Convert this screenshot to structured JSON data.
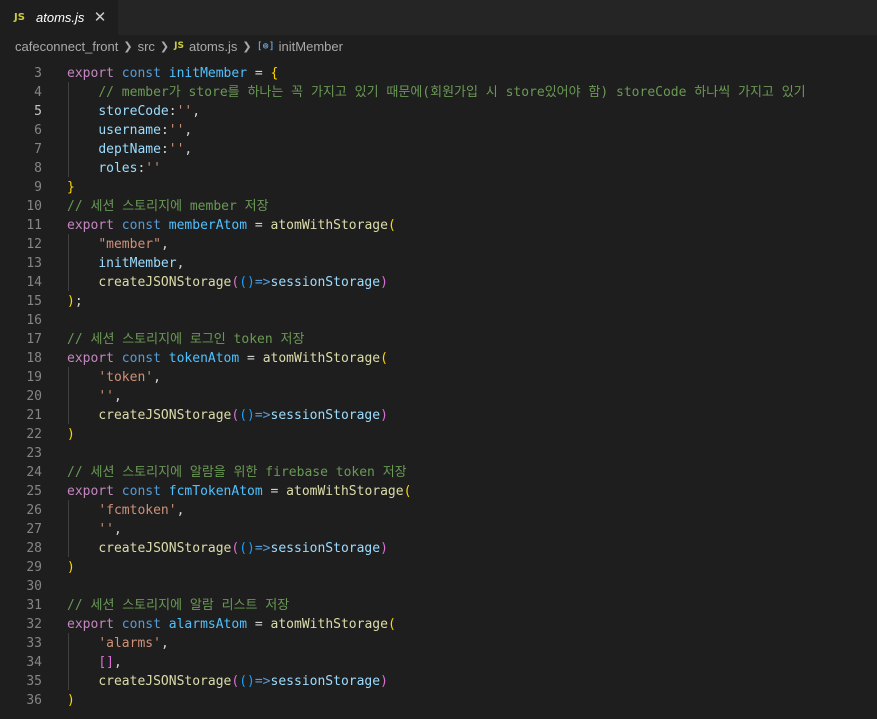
{
  "tab": {
    "icon": "JS",
    "label": "atoms.js",
    "close": "✕"
  },
  "breadcrumb": {
    "project": "cafeconnect_front",
    "folder": "src",
    "file_icon": "JS",
    "file": "atoms.js",
    "symbol_icon": "[⊚]",
    "symbol": "initMember"
  },
  "editor": {
    "active_line": "5",
    "lines": [
      {
        "n": "3",
        "t": [
          [
            "kw",
            "export"
          ],
          [
            "tx",
            " "
          ],
          [
            "st",
            "const"
          ],
          [
            "tx",
            " "
          ],
          [
            "cn",
            "initMember"
          ],
          [
            "tx",
            " = "
          ],
          [
            "b1",
            "{"
          ]
        ]
      },
      {
        "n": "4",
        "t": [
          [
            "tx",
            "    "
          ],
          [
            "cm",
            "// member가 store를 하나는 꼭 가지고 있기 때문에(회원가입 시 store있어야 함) storeCode 하나씩 가지고 있기"
          ]
        ]
      },
      {
        "n": "5",
        "t": [
          [
            "tx",
            "    "
          ],
          [
            "pr",
            "storeCode"
          ],
          [
            "tx",
            ":"
          ],
          [
            "str",
            "''"
          ],
          [
            "tx",
            ","
          ]
        ]
      },
      {
        "n": "6",
        "t": [
          [
            "tx",
            "    "
          ],
          [
            "pr",
            "username"
          ],
          [
            "tx",
            ":"
          ],
          [
            "str",
            "''"
          ],
          [
            "tx",
            ","
          ]
        ]
      },
      {
        "n": "7",
        "t": [
          [
            "tx",
            "    "
          ],
          [
            "pr",
            "deptName"
          ],
          [
            "tx",
            ":"
          ],
          [
            "str",
            "''"
          ],
          [
            "tx",
            ","
          ]
        ]
      },
      {
        "n": "8",
        "t": [
          [
            "tx",
            "    "
          ],
          [
            "pr",
            "roles"
          ],
          [
            "tx",
            ":"
          ],
          [
            "str",
            "''"
          ]
        ]
      },
      {
        "n": "9",
        "t": [
          [
            "b1",
            "}"
          ]
        ]
      },
      {
        "n": "10",
        "t": [
          [
            "cm",
            "// 세션 스토리지에 member 저장"
          ]
        ]
      },
      {
        "n": "11",
        "t": [
          [
            "kw",
            "export"
          ],
          [
            "tx",
            " "
          ],
          [
            "st",
            "const"
          ],
          [
            "tx",
            " "
          ],
          [
            "cn",
            "memberAtom"
          ],
          [
            "tx",
            " = "
          ],
          [
            "fn",
            "atomWithStorage"
          ],
          [
            "b1",
            "("
          ]
        ]
      },
      {
        "n": "12",
        "t": [
          [
            "tx",
            "    "
          ],
          [
            "str",
            "\"member\""
          ],
          [
            "tx",
            ","
          ]
        ]
      },
      {
        "n": "13",
        "t": [
          [
            "tx",
            "    "
          ],
          [
            "pr",
            "initMember"
          ],
          [
            "tx",
            ","
          ]
        ]
      },
      {
        "n": "14",
        "t": [
          [
            "tx",
            "    "
          ],
          [
            "fn",
            "createJSONStorage"
          ],
          [
            "b2",
            "("
          ],
          [
            "b3",
            "()"
          ],
          [
            "st",
            "=>"
          ],
          [
            "pr",
            "sessionStorage"
          ],
          [
            "b2",
            ")"
          ]
        ]
      },
      {
        "n": "15",
        "t": [
          [
            "b1",
            ")"
          ],
          [
            "tx",
            ";"
          ]
        ]
      },
      {
        "n": "16",
        "t": []
      },
      {
        "n": "17",
        "t": [
          [
            "cm",
            "// 세션 스토리지에 로그인 token 저장"
          ]
        ]
      },
      {
        "n": "18",
        "t": [
          [
            "kw",
            "export"
          ],
          [
            "tx",
            " "
          ],
          [
            "st",
            "const"
          ],
          [
            "tx",
            " "
          ],
          [
            "cn",
            "tokenAtom"
          ],
          [
            "tx",
            " = "
          ],
          [
            "fn",
            "atomWithStorage"
          ],
          [
            "b1",
            "("
          ]
        ]
      },
      {
        "n": "19",
        "t": [
          [
            "tx",
            "    "
          ],
          [
            "str",
            "'token'"
          ],
          [
            "tx",
            ","
          ]
        ]
      },
      {
        "n": "20",
        "t": [
          [
            "tx",
            "    "
          ],
          [
            "str",
            "''"
          ],
          [
            "tx",
            ","
          ]
        ]
      },
      {
        "n": "21",
        "t": [
          [
            "tx",
            "    "
          ],
          [
            "fn",
            "createJSONStorage"
          ],
          [
            "b2",
            "("
          ],
          [
            "b3",
            "()"
          ],
          [
            "st",
            "=>"
          ],
          [
            "pr",
            "sessionStorage"
          ],
          [
            "b2",
            ")"
          ]
        ]
      },
      {
        "n": "22",
        "t": [
          [
            "b1",
            ")"
          ]
        ]
      },
      {
        "n": "23",
        "t": []
      },
      {
        "n": "24",
        "t": [
          [
            "cm",
            "// 세션 스토리지에 알람을 위한 firebase token 저장"
          ]
        ]
      },
      {
        "n": "25",
        "t": [
          [
            "kw",
            "export"
          ],
          [
            "tx",
            " "
          ],
          [
            "st",
            "const"
          ],
          [
            "tx",
            " "
          ],
          [
            "cn",
            "fcmTokenAtom"
          ],
          [
            "tx",
            " = "
          ],
          [
            "fn",
            "atomWithStorage"
          ],
          [
            "b1",
            "("
          ]
        ]
      },
      {
        "n": "26",
        "t": [
          [
            "tx",
            "    "
          ],
          [
            "str",
            "'fcmtoken'"
          ],
          [
            "tx",
            ","
          ]
        ]
      },
      {
        "n": "27",
        "t": [
          [
            "tx",
            "    "
          ],
          [
            "str",
            "''"
          ],
          [
            "tx",
            ","
          ]
        ]
      },
      {
        "n": "28",
        "t": [
          [
            "tx",
            "    "
          ],
          [
            "fn",
            "createJSONStorage"
          ],
          [
            "b2",
            "("
          ],
          [
            "b3",
            "()"
          ],
          [
            "st",
            "=>"
          ],
          [
            "pr",
            "sessionStorage"
          ],
          [
            "b2",
            ")"
          ]
        ]
      },
      {
        "n": "29",
        "t": [
          [
            "b1",
            ")"
          ]
        ]
      },
      {
        "n": "30",
        "t": []
      },
      {
        "n": "31",
        "t": [
          [
            "cm",
            "// 세션 스토리지에 알람 리스트 저장"
          ]
        ]
      },
      {
        "n": "32",
        "t": [
          [
            "kw",
            "export"
          ],
          [
            "tx",
            " "
          ],
          [
            "st",
            "const"
          ],
          [
            "tx",
            " "
          ],
          [
            "cn",
            "alarmsAtom"
          ],
          [
            "tx",
            " = "
          ],
          [
            "fn",
            "atomWithStorage"
          ],
          [
            "b1",
            "("
          ]
        ]
      },
      {
        "n": "33",
        "t": [
          [
            "tx",
            "    "
          ],
          [
            "str",
            "'alarms'"
          ],
          [
            "tx",
            ","
          ]
        ]
      },
      {
        "n": "34",
        "t": [
          [
            "tx",
            "    "
          ],
          [
            "b2",
            "[]"
          ],
          [
            "tx",
            ","
          ]
        ]
      },
      {
        "n": "35",
        "t": [
          [
            "tx",
            "    "
          ],
          [
            "fn",
            "createJSONStorage"
          ],
          [
            "b2",
            "("
          ],
          [
            "b3",
            "()"
          ],
          [
            "st",
            "=>"
          ],
          [
            "pr",
            "sessionStorage"
          ],
          [
            "b2",
            ")"
          ]
        ]
      },
      {
        "n": "36",
        "t": [
          [
            "b1",
            ")"
          ]
        ]
      }
    ]
  }
}
